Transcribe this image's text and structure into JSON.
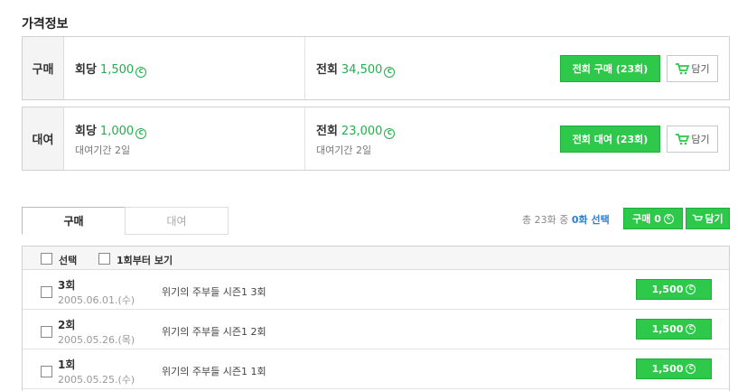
{
  "section_title": "가격정보",
  "buy_box": {
    "label": "구매",
    "per_episode_label": "회당",
    "per_episode_price": "1,500",
    "all_label": "전회",
    "all_price": "34,500",
    "action_button": "전회 구매 (23회)",
    "cart_button": "담기"
  },
  "rent_box": {
    "label": "대여",
    "per_episode_label": "회당",
    "per_episode_price": "1,000",
    "per_episode_period": "대여기간 2일",
    "all_label": "전회",
    "all_price": "23,000",
    "all_period": "대여기간 2일",
    "action_button": "전회 대여 (23회)",
    "cart_button": "담기"
  },
  "tabs": [
    {
      "label": "구매",
      "active": true
    },
    {
      "label": "대여",
      "active": false
    }
  ],
  "summary": {
    "total_prefix": "총 23화 중",
    "selected": "0화 선택",
    "buy_button": "구매 0",
    "cart_button": "담기"
  },
  "list_header": {
    "select_label": "선택",
    "from_first_label": "1회부터 보기"
  },
  "episodes": [
    {
      "number": "3회",
      "date": "2005.06.01.(수)",
      "title": "위기의 주부들 시즌1 3회",
      "price": "1,500"
    },
    {
      "number": "2회",
      "date": "2005.05.26.(목)",
      "title": "위기의 주부들 시즌1 2회",
      "price": "1,500"
    },
    {
      "number": "1회",
      "date": "2005.05.25.(수)",
      "title": "위기의 주부들 시즌1 1회",
      "price": "1,500"
    }
  ],
  "colors": {
    "accent_green": "#2ec84a",
    "price_green": "#21b04b",
    "link_blue": "#2c7ed4"
  },
  "icons": [
    "coin-icon",
    "cart-icon",
    "checkbox"
  ]
}
